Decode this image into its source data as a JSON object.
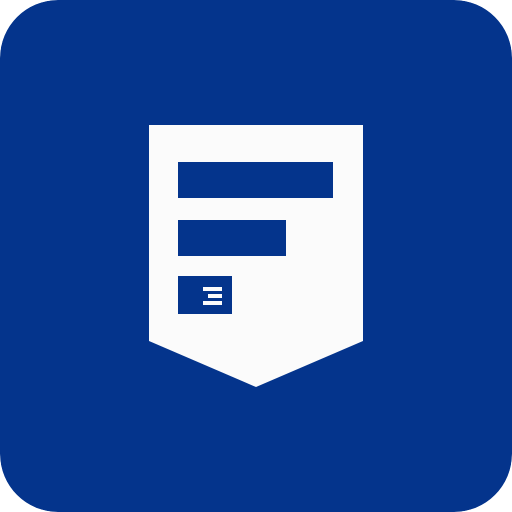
{
  "icon": {
    "name": "pocket-form-app-icon",
    "colors": {
      "background": "#04348C",
      "shield": "#FBFBFB",
      "bars": "#04348C"
    }
  }
}
